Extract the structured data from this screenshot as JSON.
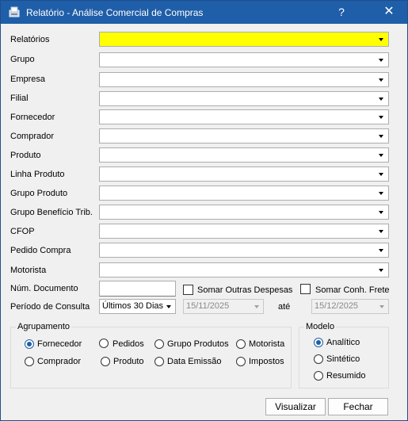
{
  "window": {
    "title": "Relatório - Análise Comercial de Compras",
    "help_label": "?",
    "close_label": "✕"
  },
  "fields": [
    {
      "label": "Relatórios",
      "value": ""
    },
    {
      "label": "Grupo",
      "value": ""
    },
    {
      "label": "Empresa",
      "value": ""
    },
    {
      "label": "Filial",
      "value": ""
    },
    {
      "label": "Fornecedor",
      "value": ""
    },
    {
      "label": "Comprador",
      "value": ""
    },
    {
      "label": "Produto",
      "value": ""
    },
    {
      "label": "Linha Produto",
      "value": ""
    },
    {
      "label": "Grupo Produto",
      "value": ""
    },
    {
      "label": "Grupo Benefício Trib.",
      "value": ""
    },
    {
      "label": "CFOP",
      "value": ""
    },
    {
      "label": "Pedido Compra",
      "value": ""
    },
    {
      "label": "Motorista",
      "value": ""
    }
  ],
  "num_documento": {
    "label": "Núm. Documento",
    "value": ""
  },
  "somar_outras": {
    "label": "Somar Outras Despesas",
    "checked": false
  },
  "somar_frete": {
    "label": "Somar Conh. Frete",
    "checked": false
  },
  "periodo": {
    "label": "Período de Consulta",
    "selected": "Últimos 30 Dias",
    "start": "15/11/2025",
    "ate_label": "até",
    "end": "15/12/2025"
  },
  "agrupamento": {
    "title": "Agrupamento",
    "options": [
      "Fornecedor",
      "Pedidos",
      "Grupo Produtos",
      "Motorista",
      "Comprador",
      "Produto",
      "Data Emissão",
      "Impostos"
    ],
    "selected": "Fornecedor"
  },
  "modelo": {
    "title": "Modelo",
    "options": [
      "Analítico",
      "Sintético",
      "Resumido"
    ],
    "selected": "Analítico"
  },
  "buttons": {
    "visualizar": "Visualizar",
    "fechar": "Fechar"
  },
  "colors": {
    "titlebar": "#1f5ea8",
    "highlight": "#ffff00"
  }
}
